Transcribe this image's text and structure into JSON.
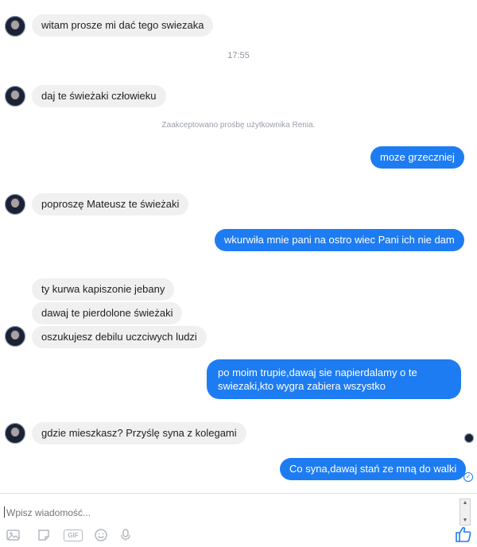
{
  "conversation": {
    "messages_in_1": "witam prosze mi dać tego swiezaka",
    "time_1": "17:55",
    "messages_in_2": "daj te świeżaki człowieku",
    "system_note": "Zaakceptowano prośbę użytkownika Renia.",
    "messages_out_1": "moze grzeczniej",
    "messages_in_3": "poproszę Mateusz te świeżaki",
    "messages_out_2": "wkurwiła mnie pani na ostro wiec Pani ich nie dam",
    "messages_in_4a": "ty kurwa kapiszonie jebany",
    "messages_in_4b": "dawaj te pierdolone świeżaki",
    "messages_in_4c": "oszukujesz debilu uczciwych ludzi",
    "messages_out_3": "po moim trupie,dawaj sie napierdalamy o te swiezaki,kto wygra zabiera wszystko",
    "messages_in_5": "gdzie mieszkasz? Przyślę syna z kolegami",
    "messages_out_4": "Co syna,dawaj stań ze mną do walki"
  },
  "composer": {
    "placeholder": "Wpisz wiadomość...",
    "gif_label": "GIF"
  },
  "colors": {
    "outgoing_bubble": "#1e7cf2",
    "incoming_bubble": "#f1f0f0"
  }
}
